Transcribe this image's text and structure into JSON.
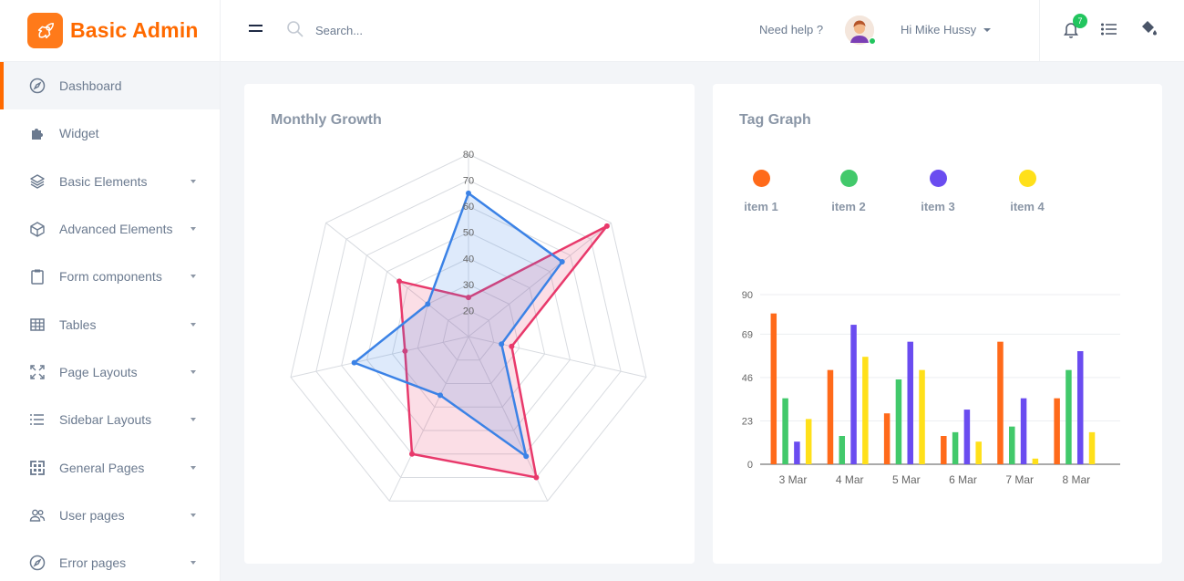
{
  "brand": {
    "name": "Basic Admin"
  },
  "sidebar": {
    "items": [
      {
        "label": "Dashboard",
        "icon": "compass-icon",
        "active": true,
        "caret": false
      },
      {
        "label": "Widget",
        "icon": "puzzle-icon",
        "active": false,
        "caret": false
      },
      {
        "label": "Basic Elements",
        "icon": "layers-icon",
        "active": false,
        "caret": true
      },
      {
        "label": "Advanced Elements",
        "icon": "cube-icon",
        "active": false,
        "caret": true
      },
      {
        "label": "Form components",
        "icon": "clipboard-icon",
        "active": false,
        "caret": true
      },
      {
        "label": "Tables",
        "icon": "table-icon",
        "active": false,
        "caret": true
      },
      {
        "label": "Page Layouts",
        "icon": "expand-icon",
        "active": false,
        "caret": true
      },
      {
        "label": "Sidebar Layouts",
        "icon": "list-icon",
        "active": false,
        "caret": true
      },
      {
        "label": "General Pages",
        "icon": "grid-icon",
        "active": false,
        "caret": true
      },
      {
        "label": "User pages",
        "icon": "users-icon",
        "active": false,
        "caret": true
      },
      {
        "label": "Error pages",
        "icon": "compass-icon",
        "active": false,
        "caret": true
      }
    ]
  },
  "header": {
    "search_placeholder": "Search...",
    "help_text": "Need help ?",
    "user_name": "Hi Mike Hussy",
    "notification_count": "7"
  },
  "cards": {
    "growth_title": "Monthly Growth",
    "tag_title": "Tag Graph"
  },
  "colors": {
    "brand": "#ff6a00",
    "radar_pink": "#e8396b",
    "radar_blue": "#3b82e6",
    "item1": "#ff6a1a",
    "item2": "#42c96b",
    "item3": "#6a4cf0",
    "item4": "#ffe01a"
  },
  "chart_data": [
    {
      "type": "radar",
      "title": "Monthly Growth",
      "r_ticks": [
        "20",
        "30",
        "40",
        "50",
        "60",
        "70",
        "80"
      ],
      "r_range": [
        20,
        80
      ],
      "axes": 7,
      "series": [
        {
          "values": [
            25,
            78,
            27,
            70,
            60,
            35,
            44
          ],
          "color": "#e8396b"
        },
        {
          "values": [
            65,
            56,
            23,
            61,
            35,
            55,
            30
          ],
          "color": "#3b82e6"
        }
      ]
    },
    {
      "type": "bar",
      "title": "Tag Graph",
      "categories": [
        "3 Mar",
        "4 Mar",
        "5 Mar",
        "6 Mar",
        "7 Mar",
        "8 Mar"
      ],
      "ylim": [
        0,
        90
      ],
      "yticks": [
        "0",
        "23",
        "46",
        "69",
        "90"
      ],
      "legend_position": "top",
      "series": [
        {
          "name": "item 1",
          "color": "#ff6a1a",
          "values": [
            80,
            50,
            27,
            15,
            65,
            35
          ]
        },
        {
          "name": "item 2",
          "color": "#42c96b",
          "values": [
            35,
            15,
            45,
            17,
            20,
            50
          ]
        },
        {
          "name": "item 3",
          "color": "#6a4cf0",
          "values": [
            12,
            74,
            65,
            29,
            35,
            60
          ]
        },
        {
          "name": "item 4",
          "color": "#ffe01a",
          "values": [
            24,
            57,
            50,
            12,
            3,
            17
          ]
        }
      ]
    }
  ]
}
